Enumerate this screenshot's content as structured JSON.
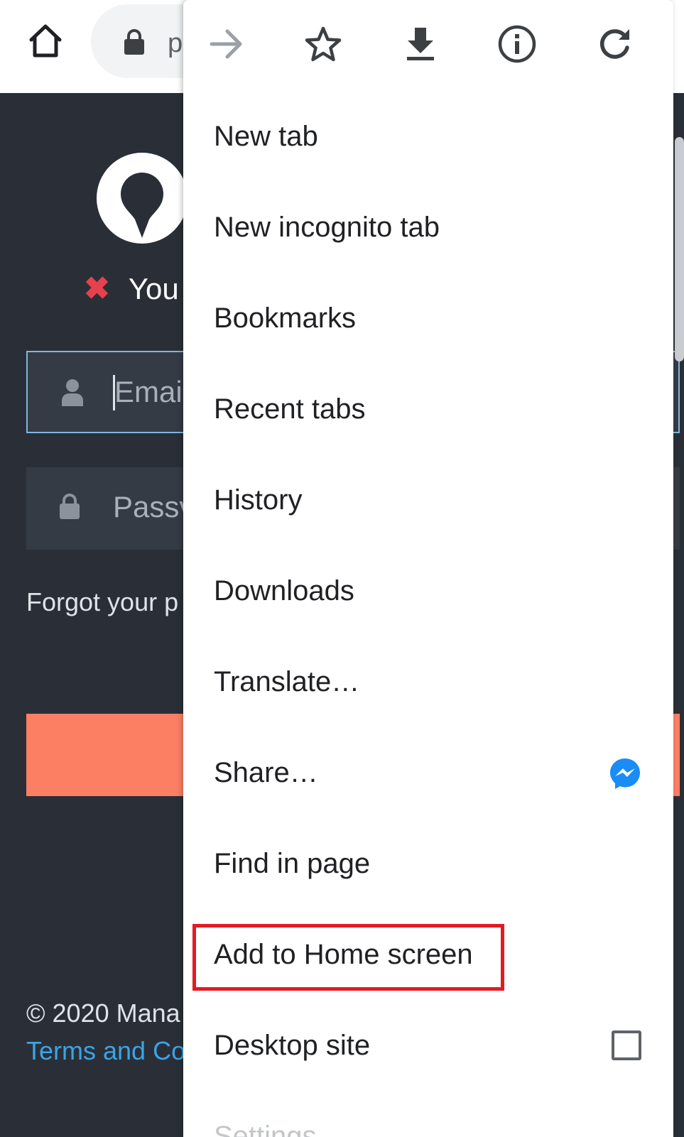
{
  "browser": {
    "url_partial": "p",
    "icons": {
      "home": "home-icon",
      "lock": "lock-icon"
    }
  },
  "page": {
    "error_text": "You",
    "email_placeholder": "Emai",
    "password_placeholder": "Passv",
    "forgot_text": "Forgot your p",
    "copyright": "© 2020 Mana",
    "terms_link": "Terms and Co",
    "colors": {
      "background": "#2a2f37",
      "accent_button": "#fd7f63",
      "error": "#e8414e",
      "link": "#3ba4e6"
    }
  },
  "menu": {
    "toolbar": {
      "forward_icon": "forward-arrow-icon",
      "bookmark_icon": "star-icon",
      "download_icon": "download-icon",
      "info_icon": "info-icon",
      "reload_icon": "reload-icon"
    },
    "items": [
      {
        "label": "New tab"
      },
      {
        "label": "New incognito tab"
      },
      {
        "label": "Bookmarks"
      },
      {
        "label": "Recent tabs"
      },
      {
        "label": "History"
      },
      {
        "label": "Downloads"
      },
      {
        "label": "Translate…"
      },
      {
        "label": "Share…",
        "trailing_icon": "messenger-icon"
      },
      {
        "label": "Find in page"
      },
      {
        "label": "Add to Home screen",
        "highlighted": true
      },
      {
        "label": "Desktop site",
        "checked": false
      },
      {
        "label": "Settings"
      }
    ],
    "highlight_color": "#e31b23"
  }
}
